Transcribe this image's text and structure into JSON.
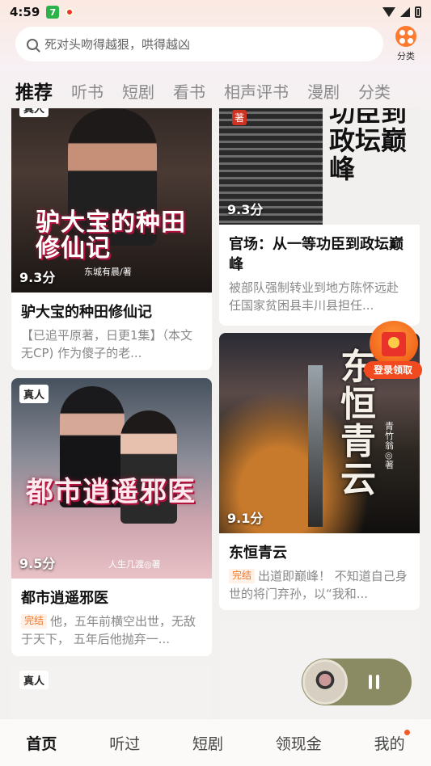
{
  "status_bar": {
    "time": "4:59",
    "app_badge": "7"
  },
  "search": {
    "placeholder": "死对头吻得越狠，哄得越凶"
  },
  "category_button": {
    "label": "分类"
  },
  "tabs": [
    {
      "label": "推荐",
      "active": true
    },
    {
      "label": "听书"
    },
    {
      "label": "短剧"
    },
    {
      "label": "看书"
    },
    {
      "label": "相声评书"
    },
    {
      "label": "漫剧"
    },
    {
      "label": "分类"
    }
  ],
  "feed": {
    "left": [
      {
        "badge": "真人",
        "cover_title": "驴大宝的种田修仙记",
        "cover_author": "东城有晨/著",
        "score": "9.3分",
        "title": "驴大宝的种田修仙记",
        "desc": "【已追平原著，日更1集】（本文无CP) 作为傻子的老..."
      },
      {
        "badge": "真人",
        "cover_title": "都市逍遥邪医",
        "cover_author": "人生几渡◎著",
        "score": "9.5分",
        "title": "都市逍遥邪医",
        "tag": "完结",
        "desc": "他，五年前横空出世，无敌于天下， 五年后他抛弃一..."
      },
      {
        "badge": "真人"
      }
    ],
    "right": [
      {
        "cover_title": "功臣到政坛巅峰",
        "cover_mark": "著",
        "score": "9.3分",
        "title": "官场：从一等功臣到政坛巅峰",
        "desc": "被部队强制转业到地方陈怀远赴任国家贫困县丰川县担任..."
      },
      {
        "cover_title": "东恒青云",
        "cover_author": "青竹翁◎著",
        "score": "9.1分",
        "title": "东恒青云",
        "tag": "完结",
        "desc": "出道即巅峰！ 不知道自己身世的将门弃孙，以“我和..."
      }
    ]
  },
  "promo": {
    "label": "登录领取"
  },
  "bottom_nav": [
    {
      "label": "首页",
      "active": true
    },
    {
      "label": "听过"
    },
    {
      "label": "短剧"
    },
    {
      "label": "领现金"
    },
    {
      "label": "我的",
      "dot": true
    }
  ],
  "colors": {
    "accent": "#f25a2a",
    "done_tag": "#f0772b",
    "player": "#8a8b63"
  }
}
